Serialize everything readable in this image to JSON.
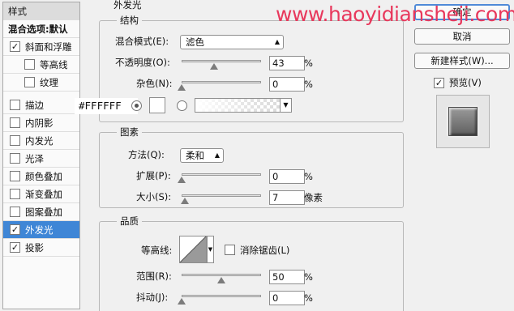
{
  "sidebar": {
    "header": "样式",
    "blend_options": "混合选项:默认",
    "items": [
      {
        "label": "斜面和浮雕",
        "checked": true
      },
      {
        "label": "等高线",
        "checked": false
      },
      {
        "label": "纹理",
        "checked": false
      },
      {
        "label": "描边",
        "checked": false
      },
      {
        "label": "内阴影",
        "checked": false
      },
      {
        "label": "内发光",
        "checked": false
      },
      {
        "label": "光泽",
        "checked": false
      },
      {
        "label": "颜色叠加",
        "checked": false
      },
      {
        "label": "渐变叠加",
        "checked": false
      },
      {
        "label": "图案叠加",
        "checked": false
      },
      {
        "label": "外发光",
        "checked": true,
        "selected": true
      },
      {
        "label": "投影",
        "checked": true
      }
    ]
  },
  "panel_title": "外发光",
  "structure": {
    "legend": "结构",
    "blend_mode_label": "混合模式(E):",
    "blend_mode_value": "滤色",
    "opacity_label": "不透明度(O):",
    "opacity_value": "43",
    "noise_label": "杂色(N):",
    "noise_value": "0",
    "percent": "%",
    "color_annotation": "#FFFFFF",
    "opacity_fraction": 0.43,
    "noise_fraction": 0
  },
  "elements": {
    "legend": "图素",
    "method_label": "方法(Q):",
    "method_value": "柔和",
    "spread_label": "扩展(P):",
    "spread_value": "0",
    "size_label": "大小(S):",
    "size_value": "7",
    "size_unit": "像素",
    "percent": "%",
    "spread_fraction": 0,
    "size_fraction": 0.02
  },
  "quality": {
    "legend": "品质",
    "contour_label": "等高线:",
    "antialias_label": "消除锯齿(L)",
    "antialias_checked": false,
    "range_label": "范围(R):",
    "range_value": "50",
    "jitter_label": "抖动(J):",
    "jitter_value": "0",
    "percent": "%",
    "range_fraction": 0.5,
    "jitter_fraction": 0
  },
  "buttons": {
    "ok": "确定",
    "cancel": "取消",
    "new_style": "新建样式(W)...",
    "preview_label": "预览(V)",
    "preview_checked": true
  },
  "watermark": "www.haoyidiansheji.com",
  "colors": {
    "accent": "#3f86d6",
    "watermark": "#e8385c",
    "glow_color": "#ffffff"
  }
}
